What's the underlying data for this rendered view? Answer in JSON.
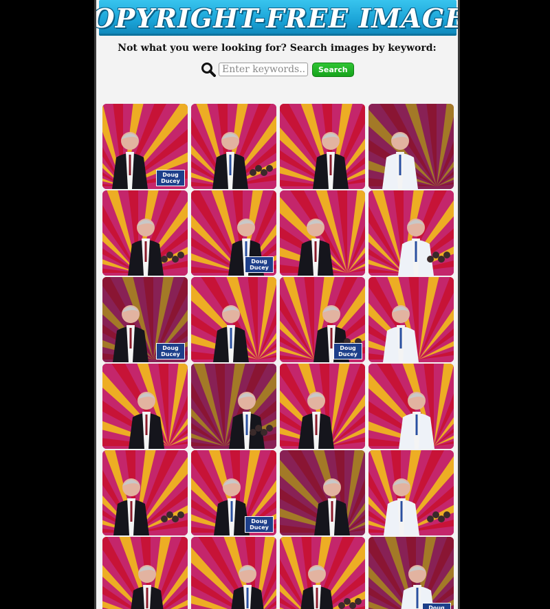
{
  "header": {
    "title": "COPYRIGHT-FREE IMAGES"
  },
  "search": {
    "prompt": "Not what you were looking for? Search images by keyword:",
    "placeholder": "Enter keywords...",
    "button_label": "Search"
  },
  "colors": {
    "banner": "#1aa2d6",
    "search_button": "#16a31b",
    "flag_red": "#c8102e",
    "flag_yellow": "#f5c518",
    "flag_magenta": "#c4266b",
    "sign_blue": "#1d3f8a"
  },
  "images": [
    {
      "id": 1,
      "sign": "Doug Ducey"
    },
    {
      "id": 2,
      "sign": ""
    },
    {
      "id": 3,
      "sign": ""
    },
    {
      "id": 4,
      "sign": ""
    },
    {
      "id": 5,
      "sign": ""
    },
    {
      "id": 6,
      "sign": "Doug Ducey"
    },
    {
      "id": 7,
      "sign": ""
    },
    {
      "id": 8,
      "sign": ""
    },
    {
      "id": 9,
      "sign": "Doug Ducey"
    },
    {
      "id": 10,
      "sign": ""
    },
    {
      "id": 11,
      "sign": "Doug Ducey"
    },
    {
      "id": 12,
      "sign": ""
    },
    {
      "id": 13,
      "sign": ""
    },
    {
      "id": 14,
      "sign": ""
    },
    {
      "id": 15,
      "sign": ""
    },
    {
      "id": 16,
      "sign": ""
    },
    {
      "id": 17,
      "sign": ""
    },
    {
      "id": 18,
      "sign": "Doug Ducey"
    },
    {
      "id": 19,
      "sign": ""
    },
    {
      "id": 20,
      "sign": ""
    },
    {
      "id": 21,
      "sign": ""
    },
    {
      "id": 22,
      "sign": ""
    },
    {
      "id": 23,
      "sign": ""
    },
    {
      "id": 24,
      "sign": "Doug Ducey"
    }
  ]
}
